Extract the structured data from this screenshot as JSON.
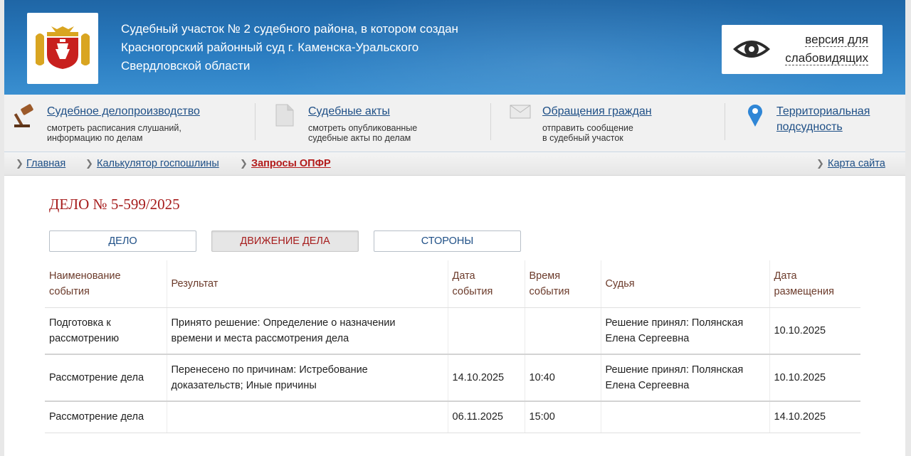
{
  "header": {
    "title_lines": [
      "Судебный участок № 2 судебного района, в котором создан",
      "Красногорский районный суд г. Каменска-Уральского",
      "Свердловской области"
    ],
    "vision_button": {
      "line1": "версия для",
      "line2": "слабовидящих",
      "icon": "eye-icon"
    }
  },
  "services": [
    {
      "icon": "gavel-icon",
      "title": "Судебное делопроизводство",
      "desc1": "смотреть расписания слушаний,",
      "desc2": "информацию по делам"
    },
    {
      "icon": "document-icon",
      "title": "Судебные акты",
      "desc1": "смотреть опубликованные",
      "desc2": "судебные акты по делам"
    },
    {
      "icon": "envelope-icon",
      "title": "Обращения граждан",
      "desc1": "отправить сообщение",
      "desc2": "в судебный участок"
    },
    {
      "icon": "map-pin-icon",
      "title_line1": "Территориальная",
      "title_line2": "подсудность"
    }
  ],
  "breadcrumbs": {
    "items": [
      "Главная",
      "Калькулятор госпошлины",
      "Запросы ОПФР"
    ],
    "sitemap": "Карта сайта"
  },
  "case": {
    "title": "ДЕЛО № 5-599/2025",
    "tabs": [
      "ДЕЛО",
      "ДВИЖЕНИЕ ДЕЛА",
      "СТОРОНЫ"
    ],
    "active_tab": "ДВИЖЕНИЕ ДЕЛА"
  },
  "table": {
    "headers": {
      "event": [
        "Наименование",
        "события"
      ],
      "result": "Результат",
      "date": [
        "Дата",
        "события"
      ],
      "time": [
        "Время",
        "события"
      ],
      "judge": "Судья",
      "posted": [
        "Дата",
        "размещения"
      ]
    },
    "rows": [
      {
        "event": [
          "Подготовка к",
          "рассмотрению"
        ],
        "result": [
          "Принято решение: Определение о назначении",
          "времени и места рассмотрения дела"
        ],
        "date": "",
        "time": "",
        "judge": [
          "Решение принял: Полянская",
          "Елена Сергеевна"
        ],
        "posted": "10.10.2025"
      },
      {
        "event": [
          "Рассмотрение дела",
          ""
        ],
        "result": [
          "Перенесено по причинам: Истребование",
          "доказательств; Иные причины"
        ],
        "date": "14.10.2025",
        "time": "10:40",
        "judge": [
          "Решение принял: Полянская",
          "Елена Сергеевна"
        ],
        "posted": "10.10.2025"
      },
      {
        "event": [
          "Рассмотрение дела",
          ""
        ],
        "result": [
          "",
          ""
        ],
        "date": "06.11.2025",
        "time": "15:00",
        "judge": [
          "",
          ""
        ],
        "posted": "14.10.2025"
      }
    ]
  },
  "colors": {
    "header_blue": "#2a7cc0",
    "link": "#1e4f86",
    "accent_red": "#a61c1c"
  }
}
